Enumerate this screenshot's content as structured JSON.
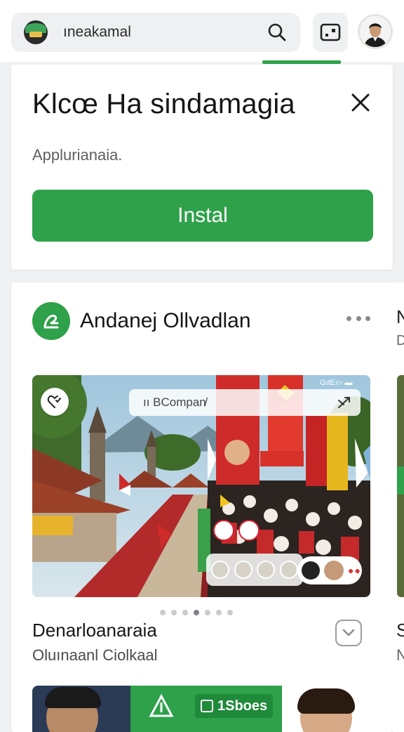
{
  "search": {
    "query": "ıneakamal",
    "app_icon": "app-logo-icon",
    "search_icon": "search-icon"
  },
  "toolbar": {
    "cast_icon": "cast-icon",
    "avatar": "user-avatar"
  },
  "install_card": {
    "title": "Klcœ Ha sindamagia",
    "subtitle": "Applurianaia.",
    "button_label": "Instal",
    "close_icon": "close-icon"
  },
  "feed": {
    "channel_name": "Andanej Ollvadlan",
    "more_icon": "more-icon",
    "hero": {
      "search_chip": "ıı BCompan̸",
      "status_text": "GıtE▭ ▬"
    },
    "carousel": {
      "count": 7,
      "active": 3
    },
    "item_title": "Denarloanaraia",
    "item_subtitle": "Oluınaanl Ciolkaal",
    "promo": {
      "score": "1Sboes"
    }
  },
  "peek_card": {
    "line1": "N",
    "line2": "D",
    "line3": "S",
    "line4": "N"
  },
  "colors": {
    "accent": "#2ea14a",
    "background": "#f0f1f3",
    "card": "#ffffff"
  }
}
